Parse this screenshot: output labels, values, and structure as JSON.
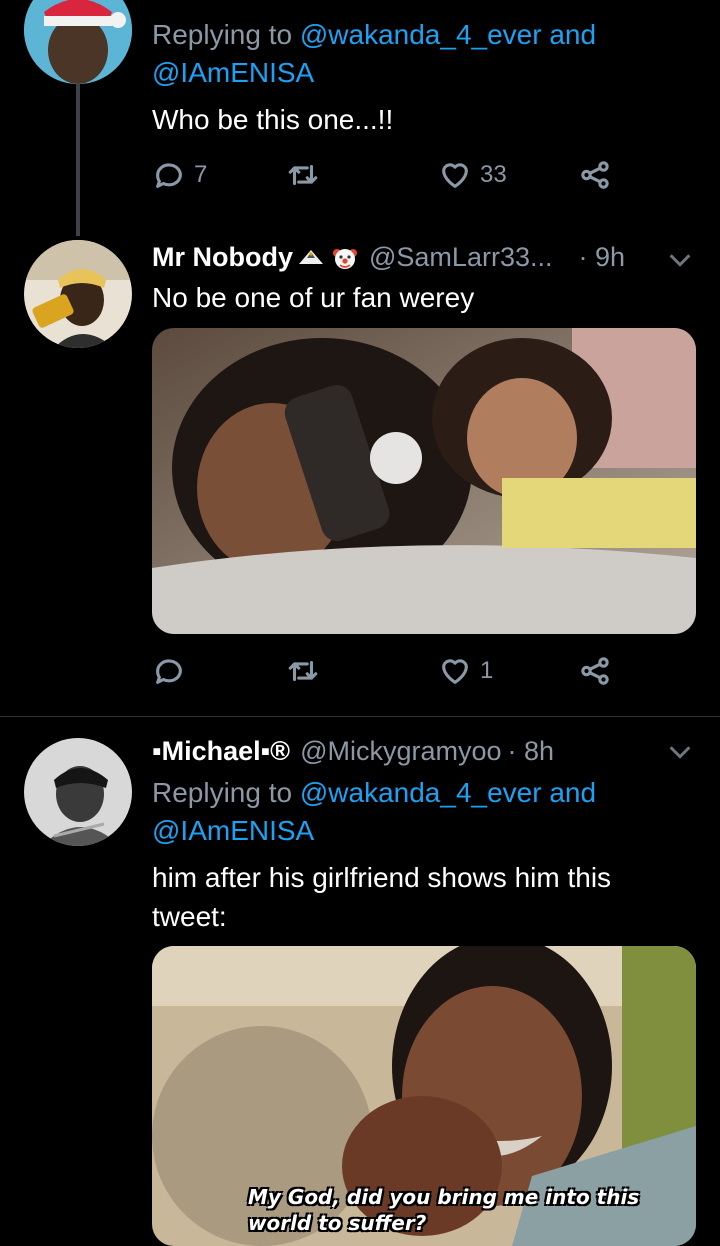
{
  "tweets": [
    {
      "reply_prefix": "Replying to ",
      "reply_mentions": [
        "@wakanda_4_ever",
        "@IAmENISA"
      ],
      "reply_and": " and",
      "text": "Who be this one...!!",
      "replies": "7",
      "retweets": "",
      "likes": "33"
    },
    {
      "name": "Mr Nobody",
      "handle": "@SamLarr33...",
      "time": "· 9h",
      "text": "No be one of ur fan werey",
      "replies": "",
      "retweets": "",
      "likes": "1",
      "emojis": [
        "eagle-emoji",
        "clown-face-emoji"
      ]
    },
    {
      "name": "▪Michael▪®",
      "handle": "@Mickygramyoo",
      "time": "· 8h",
      "reply_prefix": "Replying to ",
      "reply_mentions": [
        "@wakanda_4_ever",
        "@IAmENISA"
      ],
      "reply_and": " and",
      "text": "him after his girlfriend shows him this tweet:",
      "media_caption": "My God, did you bring me into this world to suffer?"
    }
  ],
  "colors": {
    "background": "#000000",
    "link": "#1da1f2",
    "secondary_text": "#8b98a5",
    "divider": "#2f3336"
  }
}
